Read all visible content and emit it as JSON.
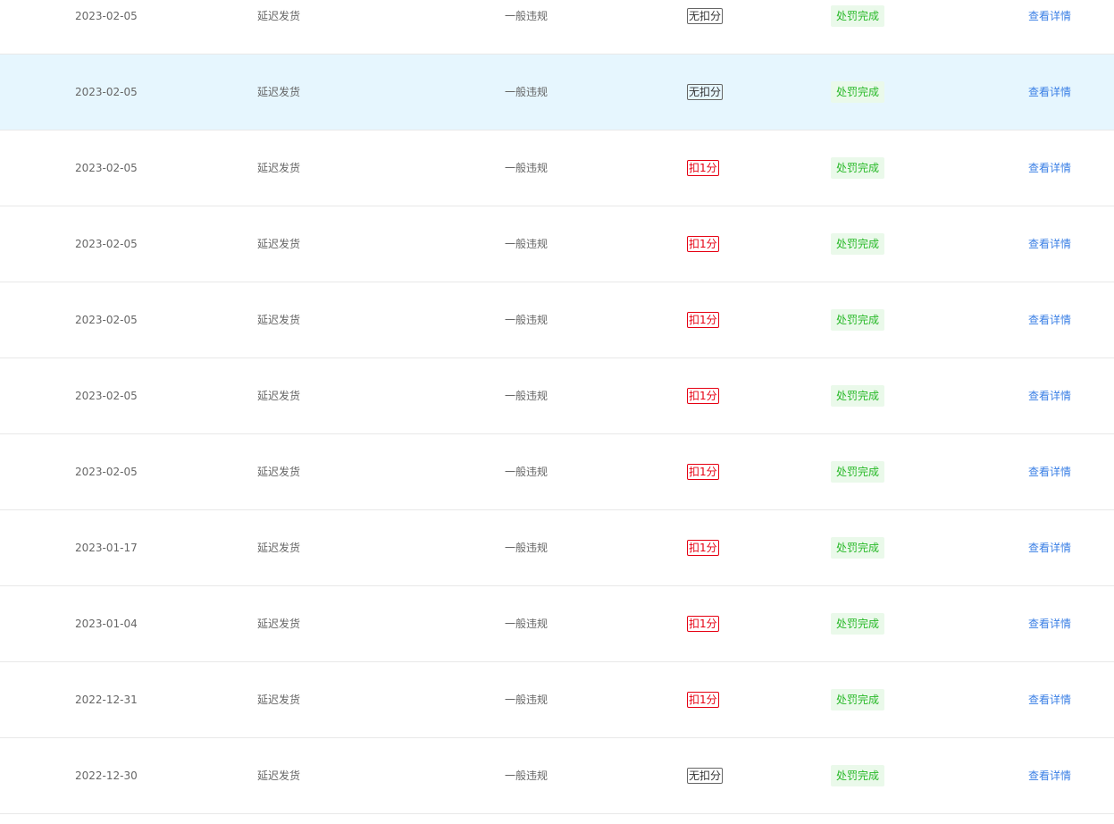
{
  "table": {
    "rows": [
      {
        "date": "2023-02-05",
        "type": "延迟发货",
        "level": "一般违规",
        "score": "无扣分",
        "score_color": "#333333",
        "status": "处罚完成",
        "action": "查看详情",
        "highlighted": false
      },
      {
        "date": "2023-02-05",
        "type": "延迟发货",
        "level": "一般违规",
        "score": "无扣分",
        "score_color": "#333333",
        "status": "处罚完成",
        "action": "查看详情",
        "highlighted": true
      },
      {
        "date": "2023-02-05",
        "type": "延迟发货",
        "level": "一般违规",
        "score": "扣1分",
        "score_color": "#e60012",
        "status": "处罚完成",
        "action": "查看详情",
        "highlighted": false
      },
      {
        "date": "2023-02-05",
        "type": "延迟发货",
        "level": "一般违规",
        "score": "扣1分",
        "score_color": "#e60012",
        "status": "处罚完成",
        "action": "查看详情",
        "highlighted": false
      },
      {
        "date": "2023-02-05",
        "type": "延迟发货",
        "level": "一般违规",
        "score": "扣1分",
        "score_color": "#e60012",
        "status": "处罚完成",
        "action": "查看详情",
        "highlighted": false
      },
      {
        "date": "2023-02-05",
        "type": "延迟发货",
        "level": "一般违规",
        "score": "扣1分",
        "score_color": "#e60012",
        "status": "处罚完成",
        "action": "查看详情",
        "highlighted": false
      },
      {
        "date": "2023-02-05",
        "type": "延迟发货",
        "level": "一般违规",
        "score": "扣1分",
        "score_color": "#e60012",
        "status": "处罚完成",
        "action": "查看详情",
        "highlighted": false
      },
      {
        "date": "2023-01-17",
        "type": "延迟发货",
        "level": "一般违规",
        "score": "扣1分",
        "score_color": "#e60012",
        "status": "处罚完成",
        "action": "查看详情",
        "highlighted": false
      },
      {
        "date": "2023-01-04",
        "type": "延迟发货",
        "level": "一般违规",
        "score": "扣1分",
        "score_color": "#e60012",
        "status": "处罚完成",
        "action": "查看详情",
        "highlighted": false
      },
      {
        "date": "2022-12-31",
        "type": "延迟发货",
        "level": "一般违规",
        "score": "扣1分",
        "score_color": "#e60012",
        "status": "处罚完成",
        "action": "查看详情",
        "highlighted": false
      },
      {
        "date": "2022-12-30",
        "type": "延迟发货",
        "level": "一般违规",
        "score": "无扣分",
        "score_color": "#333333",
        "status": "处罚完成",
        "action": "查看详情",
        "highlighted": false
      }
    ]
  },
  "colors": {
    "link": "#3a7fe5",
    "status_text": "#28b928",
    "status_bg": "#eaf9ea",
    "highlight_row": "#e6f6fe",
    "deduct_red": "#e60012"
  }
}
